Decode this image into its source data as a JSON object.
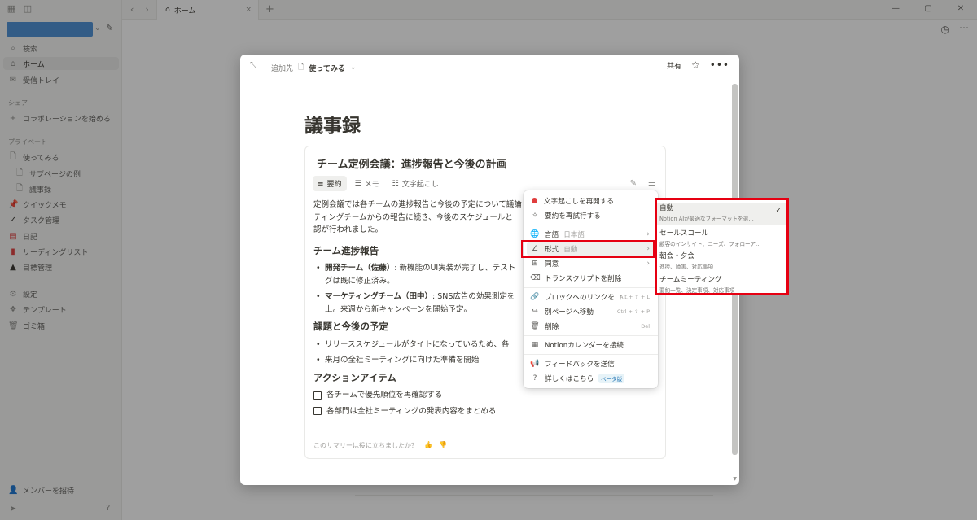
{
  "tab": {
    "title": "ホーム"
  },
  "sidebar": {
    "nav": [
      {
        "label": "検索",
        "icon": "search-icon"
      },
      {
        "label": "ホーム",
        "icon": "home-icon"
      },
      {
        "label": "受信トレイ",
        "icon": "inbox-icon"
      }
    ],
    "share_section": "シェア",
    "collab": "コラボレーションを始める",
    "private_section": "プライベート",
    "pages": [
      {
        "label": "使ってみる"
      },
      {
        "label": "サブページの例"
      },
      {
        "label": "議事録"
      },
      {
        "label": "クイックメモ"
      },
      {
        "label": "タスク管理"
      },
      {
        "label": "日記"
      },
      {
        "label": "リーディングリスト"
      },
      {
        "label": "目標管理"
      }
    ],
    "bottom": [
      {
        "label": "設定"
      },
      {
        "label": "テンプレート"
      },
      {
        "label": "ゴミ箱"
      }
    ],
    "invite": "メンバーを招待"
  },
  "modal": {
    "breadcrumb_prefix": "追加先",
    "breadcrumb_page": "使ってみる",
    "share": "共有",
    "doc_title": "議事録",
    "card": {
      "title": "チーム定例会議：進捗報告と今後の計画",
      "tabs": [
        "要約",
        "メモ",
        "文字起こし"
      ],
      "intro": "定例会議では各チームの進捗報告と今後の予定について議論",
      "intro2": "ティングチームからの報告に続き、今後のスケジュールと",
      "intro3": "認が行われました。",
      "h1": "チーム進捗報告",
      "b1_strong": "開発チーム（佐藤）",
      "b1_text": ": 新機能のUI実装が完了し、テスト",
      "b1_text2": "グは既に修正済み。",
      "b2_strong": "マーケティングチーム（田中）",
      "b2_text": ": SNS広告の効果測定を",
      "b2_text2": "上。来週から新キャンペーンを開始予定。",
      "h2": "課題と今後の予定",
      "c1": "リリーススケジュールがタイトになっているため、各",
      "c2": "来月の全社ミーティングに向けた準備を開始",
      "h3": "アクションアイテム",
      "todo1": "各チームで優先順位を再確認する",
      "todo2": "各部門は全社ミーティングの発表内容をまとめる",
      "feedback": "このサマリーは役に立ちましたか？"
    }
  },
  "menu": {
    "resume": "文字起こしを再開する",
    "retry": "要約を再試行する",
    "language_label": "言語",
    "language_value": "日本語",
    "format_label": "形式",
    "format_value": "自動",
    "consent": "同意",
    "delete_transcript": "トランスクリプトを削除",
    "copy_link": "ブロックへのリンクをコ…",
    "copy_link_kbd": "Alt + ⇧ + L",
    "move": "別ページへ移動",
    "move_kbd": "Ctrl + ⇧ + P",
    "delete": "削除",
    "delete_kbd": "Del",
    "calendar": "Notionカレンダーを接続",
    "send_feedback": "フィードバックを送信",
    "learn_more": "詳しくはこちら",
    "beta": "ベータ版"
  },
  "submenu": [
    {
      "name": "自動",
      "desc": "Notion AIが最適なフォーマットを選…",
      "selected": true
    },
    {
      "name": "セールスコール",
      "desc": "顧客のインサイト、ニーズ、フォローア…"
    },
    {
      "name": "朝会・夕会",
      "desc": "進捗、障害、対応事項"
    },
    {
      "name": "チームミーティング",
      "desc": "要約一覧、決定事項、対応事項"
    }
  ],
  "colors": {
    "accent": "#e60012",
    "workspace": "#4c8fd6"
  }
}
